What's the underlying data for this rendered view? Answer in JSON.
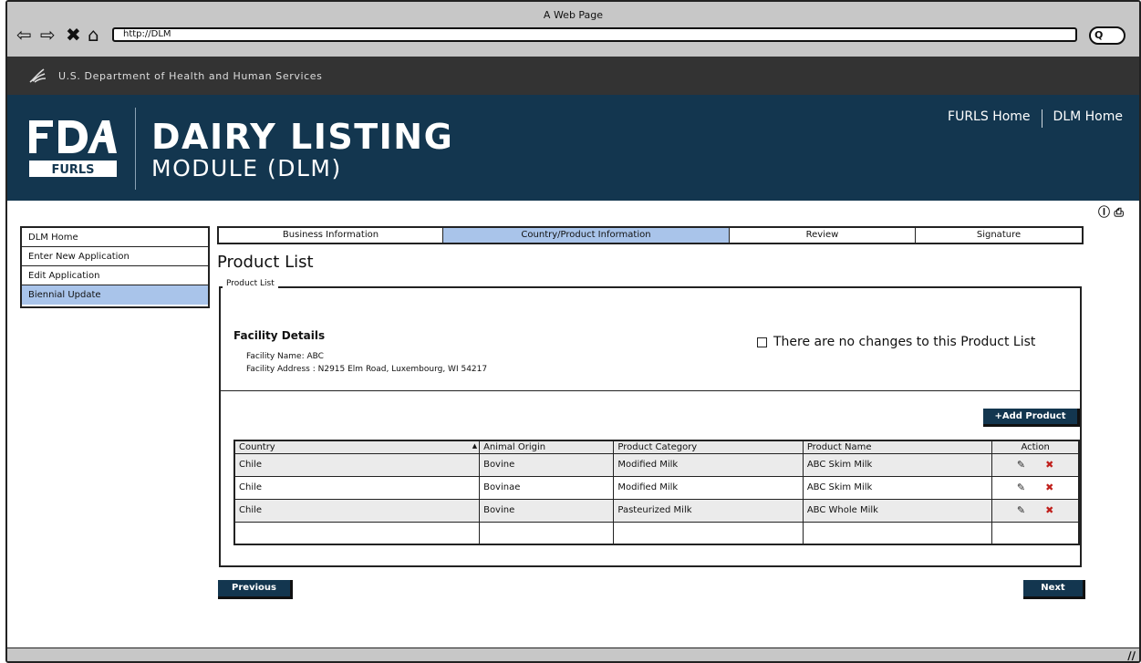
{
  "browser": {
    "window_title": "A Web Page",
    "url": "http://DLM",
    "search_label": "Q"
  },
  "agency_bar": {
    "text": "U.S. Department of Health and Human Services"
  },
  "header": {
    "logo_top": "FDA",
    "logo_bottom": "FURLS",
    "title_line1": "DAIRY LISTING",
    "title_line2": "MODULE (DLM)",
    "links": [
      "FURLS Home",
      "DLM Home"
    ]
  },
  "sidebar": {
    "items": [
      {
        "label": "DLM Home",
        "active": false
      },
      {
        "label": "Enter New Application",
        "active": false
      },
      {
        "label": "Edit Application",
        "active": false
      },
      {
        "label": "Biennial Update",
        "active": true
      }
    ]
  },
  "wizard": {
    "steps": [
      {
        "label": "Business Information",
        "active": false
      },
      {
        "label": "Country/Product Information",
        "active": true
      },
      {
        "label": "Review",
        "active": false
      },
      {
        "label": "Signature",
        "active": false
      }
    ]
  },
  "page": {
    "title": "Product List",
    "legend": "Product List",
    "facility_title": "Facility Details",
    "facility_name": "Facility Name: ABC",
    "facility_address": "Facility Address : N2915 Elm Road, Luxembourg, WI 54217",
    "no_changes_label": "There are no changes to this Product List",
    "add_product_label": "+Add Product",
    "previous_label": "Previous",
    "next_label": "Next"
  },
  "table": {
    "columns": [
      "Country",
      "Animal Origin",
      "Product Category",
      "Product Name",
      "Action"
    ],
    "rows": [
      [
        "Chile",
        "Bovine",
        "Modified Milk",
        "ABC Skim Milk"
      ],
      [
        "Chile",
        "Bovinae",
        "Modified Milk",
        "ABC Skim Milk"
      ],
      [
        "Chile",
        "Bovine",
        "Pasteurized Milk",
        "ABC Whole Milk"
      ],
      [
        "",
        "",
        "",
        ""
      ]
    ]
  },
  "colors": {
    "header_bg": "#13364f",
    "agency_bar_bg": "#333333",
    "active_highlight": "#a9c4ea",
    "delete_icon": "#c0201c"
  },
  "icons": {
    "back": "back-arrow-icon",
    "forward": "forward-arrow-icon",
    "stop": "close-icon",
    "home": "home-icon",
    "help": "help-icon",
    "print": "print-icon",
    "edit": "pencil-icon",
    "delete": "delete-x-icon"
  }
}
